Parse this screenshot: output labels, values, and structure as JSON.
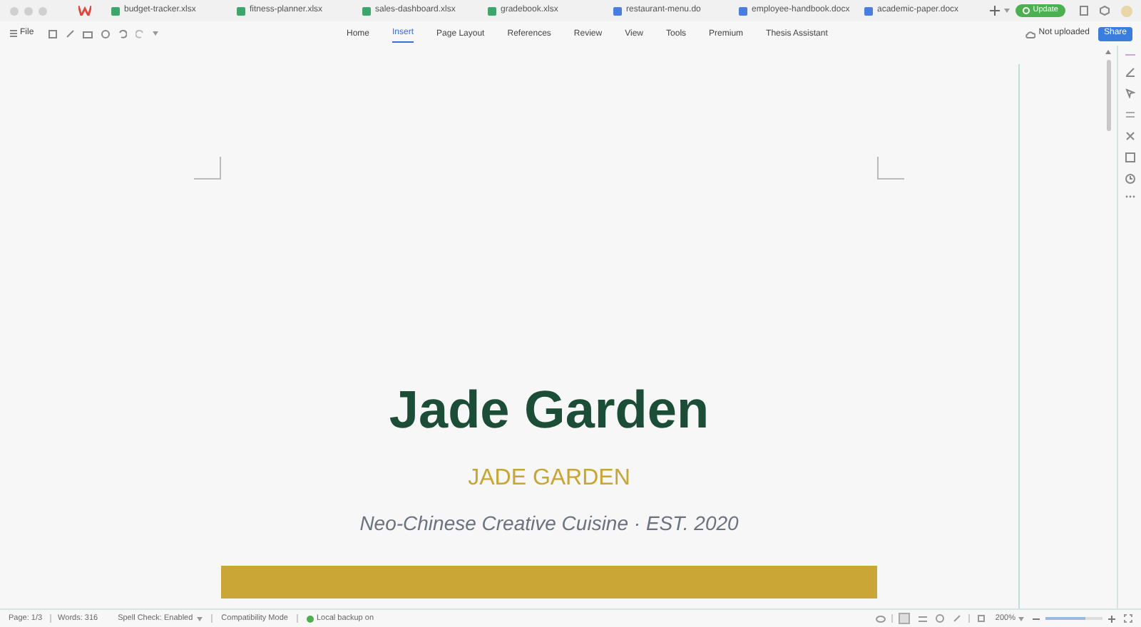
{
  "tabs": [
    {
      "label": "budget-tracker.xlsx",
      "kind": "sheet"
    },
    {
      "label": "fitness-planner.xlsx",
      "kind": "sheet"
    },
    {
      "label": "sales-dashboard.xlsx",
      "kind": "sheet"
    },
    {
      "label": "gradebook.xlsx",
      "kind": "sheet"
    },
    {
      "label": "restaurant-menu.do",
      "kind": "doc"
    },
    {
      "label": "employee-handbook.docx",
      "kind": "doc"
    },
    {
      "label": "academic-paper.docx",
      "kind": "doc"
    }
  ],
  "update_button": "Update",
  "file_menu": "File",
  "ribbon_tabs": [
    {
      "label": "Home",
      "selected": false
    },
    {
      "label": "Insert",
      "selected": true
    },
    {
      "label": "Page Layout",
      "selected": false
    },
    {
      "label": "References",
      "selected": false
    },
    {
      "label": "Review",
      "selected": false
    },
    {
      "label": "View",
      "selected": false
    },
    {
      "label": "Tools",
      "selected": false
    },
    {
      "label": "Premium",
      "selected": false
    },
    {
      "label": "Thesis Assistant",
      "selected": false
    }
  ],
  "cloud_status": "Not uploaded",
  "share_button": "Share",
  "document": {
    "title": "Jade Garden",
    "subtitle": "JADE GARDEN",
    "tagline": "Neo-Chinese Creative Cuisine · EST. 2020"
  },
  "status_bar": {
    "page": "Page: 1/3",
    "words": "Words: 316",
    "spell_check": "Spell Check: Enabled",
    "mode": "Compatibility Mode",
    "backup": "Local backup on",
    "zoom": "200%"
  },
  "zoom_slider": {
    "level": 0.7
  }
}
